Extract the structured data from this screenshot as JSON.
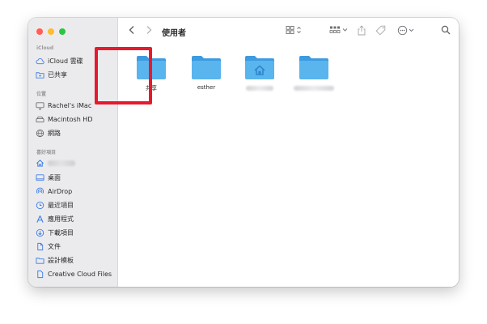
{
  "window": {
    "title": "使用者"
  },
  "sidebar": {
    "sections": [
      {
        "title": "iCloud",
        "items": [
          {
            "label": "iCloud 雲碟",
            "icon": "cloud-icon"
          },
          {
            "label": "已共享",
            "icon": "shared-folder-icon"
          }
        ]
      },
      {
        "title": "位置",
        "items": [
          {
            "label": "Rachel's iMac",
            "icon": "imac-icon"
          },
          {
            "label": "Macintosh HD",
            "icon": "hard-drive-icon"
          },
          {
            "label": "網路",
            "icon": "network-icon"
          }
        ]
      },
      {
        "title": "喜好項目",
        "items": [
          {
            "label": "",
            "icon": "home-icon"
          },
          {
            "label": "桌面",
            "icon": "desktop-icon"
          },
          {
            "label": "AirDrop",
            "icon": "airdrop-icon"
          },
          {
            "label": "最近項目",
            "icon": "clock-icon"
          },
          {
            "label": "應用程式",
            "icon": "applications-icon"
          },
          {
            "label": "下載項目",
            "icon": "download-icon"
          },
          {
            "label": "文件",
            "icon": "document-icon"
          },
          {
            "label": "設計模板",
            "icon": "folder-icon"
          },
          {
            "label": "Creative Cloud Files",
            "icon": "creative-cloud-file-icon"
          }
        ]
      }
    ]
  },
  "folders": [
    {
      "label": "共享",
      "type": "plain",
      "highlighted": true
    },
    {
      "label": "esther",
      "type": "plain"
    },
    {
      "label": "",
      "type": "home"
    },
    {
      "label": "",
      "type": "plain"
    }
  ],
  "colors": {
    "highlight": "#e8192c",
    "folder": "#5ab4ee",
    "accent": "#3f7ee8"
  }
}
